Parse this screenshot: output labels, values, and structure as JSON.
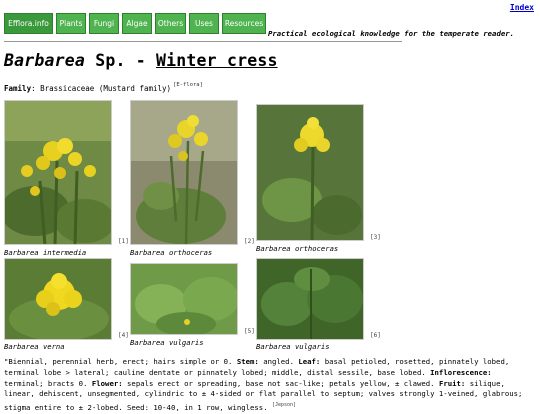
{
  "index_link": "Index",
  "nav": [
    "Efflora.info",
    "Plants",
    "Fungi",
    "Algae",
    "Others",
    "Uses",
    "Resources"
  ],
  "tagline": "Practical ecological knowledge for the temperate reader.",
  "title": {
    "genus": "Barbarea",
    "sp": " Sp. - ",
    "common": "Winter cress"
  },
  "family": {
    "label": "Family",
    "value": " Brassicaceae (Mustard family)",
    "ref": "[E-flora]"
  },
  "photos": [
    {
      "caption": "Barbarea intermedia",
      "ref": "[1]"
    },
    {
      "caption": "Barbarea orthoceras",
      "ref": "[2]"
    },
    {
      "caption": "Barbarea orthoceras",
      "ref": "[3]"
    },
    {
      "caption": "Barbarea verna",
      "ref": "[4]"
    },
    {
      "caption": "Barbarea vulgaris",
      "ref": "[5]"
    },
    {
      "caption": "Barbarea vulgaris",
      "ref": "[6]"
    }
  ],
  "description": {
    "intro": "\"Biennial, perennial herb, erect; hairs simple or 0. ",
    "stem_label": "Stem:",
    "stem": " angled. ",
    "leaf_label": "Leaf:",
    "leaf": " basal petioled, rosetted, pinnately lobed, terminal lobe > lateral; cauline dentate or pinnately lobed; middle, distal sessile, base lobed. ",
    "inflo_label": "Inflorescence:",
    "inflo": " terminal; bracts 0. ",
    "flower_label": "Flower:",
    "flower": " sepals erect or spreading, base not sac-like; petals yellow, ± clawed. ",
    "fruit_label": "Fruit:",
    "fruit": " silique, linear, dehiscent, unsegmented, cylindric to ± 4-sided or flat parallel to septum; valves strongly 1-veined, glabrous; stigma entire to ± 2-lobed. Seed: 10-40, in 1 row, wingless.",
    "ref": "[Jepson]"
  }
}
